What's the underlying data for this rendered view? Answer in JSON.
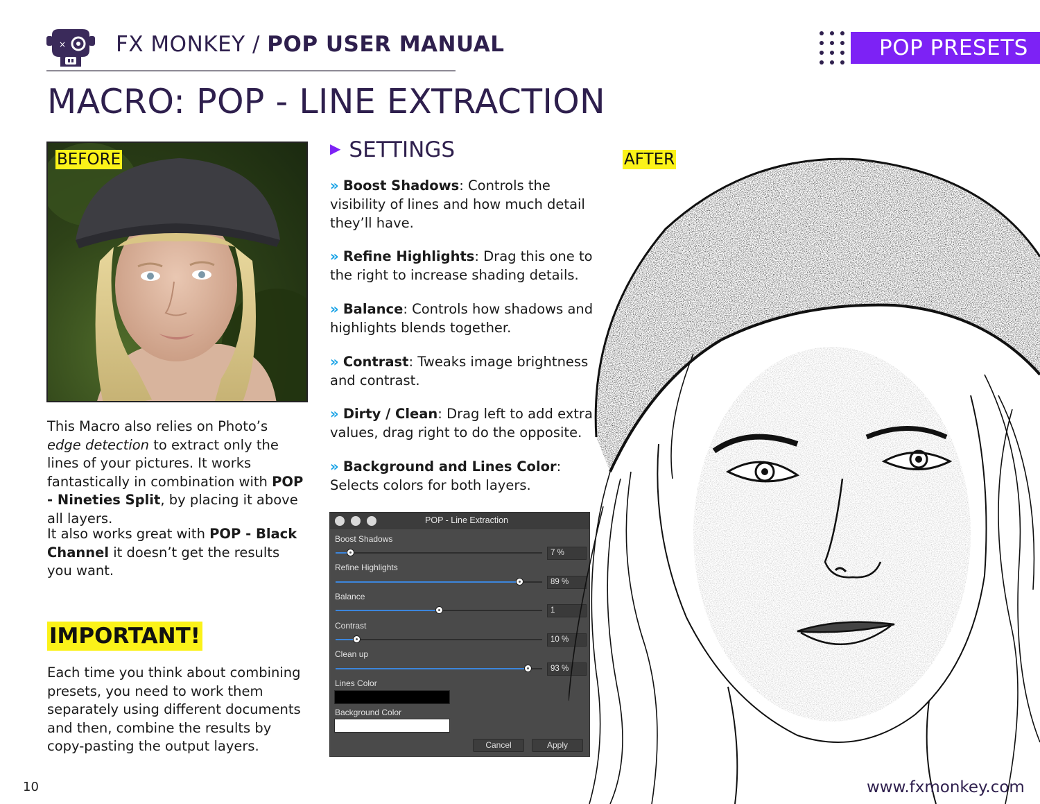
{
  "header": {
    "brand": "FX MONKEY",
    "separator": " / ",
    "manual": "POP USER MANUAL",
    "section_tag": "POP PRESETS"
  },
  "page_title": {
    "prefix": "MACRO: ",
    "main": "POP - LINE EXTRACTION"
  },
  "labels": {
    "before": "BEFORE",
    "after": "AFTER"
  },
  "left_column": {
    "p1": {
      "a": "This Macro also relies on Photo’s ",
      "b_italic": "edge detection",
      "c": " to extract only the lines of your pictures. It works fantastically in combination with ",
      "d_bold": "POP - Nineties Split",
      "e": ", by placing it above all layers."
    },
    "p2": {
      "a": "It also works great with ",
      "b_bold": "POP - Black Channel",
      "c": " it doesn’t get the results you want."
    },
    "important": "IMPORTANT!",
    "p3": "Each time you think about combining presets, you need to work them separately using different documents and then, combine the results by copy-pasting the output layers."
  },
  "settings": {
    "heading": "SETTINGS",
    "chevron": "»",
    "items": [
      {
        "name": "Boost Shadows",
        "text": ": Controls the visibility of lines and how much detail they’ll have."
      },
      {
        "name": "Refine Highlights",
        "text": ": Drag this one to the right to increase shading details."
      },
      {
        "name": "Balance",
        "text": ": Controls how shadows and highlights blends together."
      },
      {
        "name": "Contrast",
        "text": ": Tweaks image brightness and contrast."
      },
      {
        "name": "Dirty / Clean",
        "text": ": Drag left to add extra values, drag right to do the opposite."
      },
      {
        "name": "Background and Lines Color",
        "text": ": Selects colors for both layers."
      }
    ]
  },
  "dialog": {
    "title": "POP - Line Extraction",
    "sliders": [
      {
        "label": "Boost Shadows",
        "value": "7 %",
        "fraction": 0.07
      },
      {
        "label": "Refine Highlights",
        "value": "89 %",
        "fraction": 0.89
      },
      {
        "label": "Balance",
        "value": "1",
        "fraction": 0.5
      },
      {
        "label": "Contrast",
        "value": "10 %",
        "fraction": 0.1
      },
      {
        "label": "Clean up",
        "value": "93 %",
        "fraction": 0.93
      }
    ],
    "lines_color_label": "Lines Color",
    "lines_color": "#000000",
    "background_color_label": "Background Color",
    "background_color": "#ffffff",
    "cancel": "Cancel",
    "apply": "Apply"
  },
  "footer": {
    "page_number": "10",
    "url": "www.fxmonkey.com"
  },
  "colors": {
    "accent_purple": "#7d22f5",
    "title_dark": "#2e1f4d",
    "highlight_yellow": "#fbf219",
    "chevron_blue": "#1aa3e6",
    "slider_blue": "#3c86dd"
  }
}
